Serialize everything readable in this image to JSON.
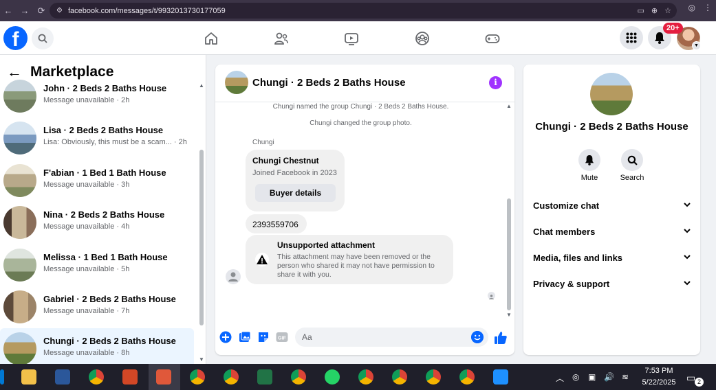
{
  "browser": {
    "url": "facebook.com/messages/t/9932013730177059"
  },
  "topbar": {
    "logo": "f",
    "notification_badge": "20+"
  },
  "sidebar": {
    "title": "Marketplace",
    "conversations": [
      {
        "name": "John · 2 Beds 2 Baths House",
        "preview": "Message unavailable · 2h",
        "thumb_color": "#8a9a7a"
      },
      {
        "name": "Lisa · 2 Beds 2 Baths House",
        "preview": "Lisa: Obviously, this must be a scam... · 2h",
        "thumb_color": "#7b9ac0"
      },
      {
        "name": "F'abian · 1 Bed 1 Bath House",
        "preview": "Message unavailable · 3h",
        "thumb_color": "#b8a98a"
      },
      {
        "name": "Nina · 2 Beds 2 Baths House",
        "preview": "Message unavailable · 4h",
        "thumb_color": "#8a6e5a"
      },
      {
        "name": "Melissa · 1 Bed 1 Bath House",
        "preview": "Message unavailable · 5h",
        "thumb_color": "#a9b59a"
      },
      {
        "name": "Gabriel · 2 Beds 2 Baths House",
        "preview": "Message unavailable · 7h",
        "thumb_color": "#9c8468"
      },
      {
        "name": "Chungi · 2 Beds 2 Baths House",
        "preview": "Message unavailable · 8h",
        "thumb_color": "#b59a60"
      }
    ]
  },
  "chat": {
    "title": "Chungi · 2 Beds 2 Baths House",
    "system_messages": [
      "Chungi named the group Chungi · 2 Beds 2 Baths House.",
      "Chungi changed the group photo."
    ],
    "sender": "Chungi",
    "contact_card": {
      "name": "Chungi Chestnut",
      "joined": "Joined Facebook in 2023",
      "button": "Buyer details"
    },
    "phone_message": "2393559706",
    "attachment": {
      "title": "Unsupported attachment",
      "body": "This attachment may have been removed or the person who shared it may not have permission to share it with you."
    },
    "composer_placeholder": "Aa",
    "gif_label": "GIF"
  },
  "info_panel": {
    "title": "Chungi · 2 Beds 2 Baths House",
    "actions": [
      {
        "label": "Mute",
        "icon": "bell-icon"
      },
      {
        "label": "Search",
        "icon": "search-icon"
      }
    ],
    "sections": [
      "Customize chat",
      "Chat members",
      "Media, files and links",
      "Privacy & support"
    ]
  },
  "taskbar": {
    "time": "7:53 PM",
    "date": "5/22/2025",
    "notification_count": "2"
  },
  "colors": {
    "fb_blue": "#0866ff",
    "info_purple": "#a033ff",
    "badge_red": "#e41e3f"
  }
}
